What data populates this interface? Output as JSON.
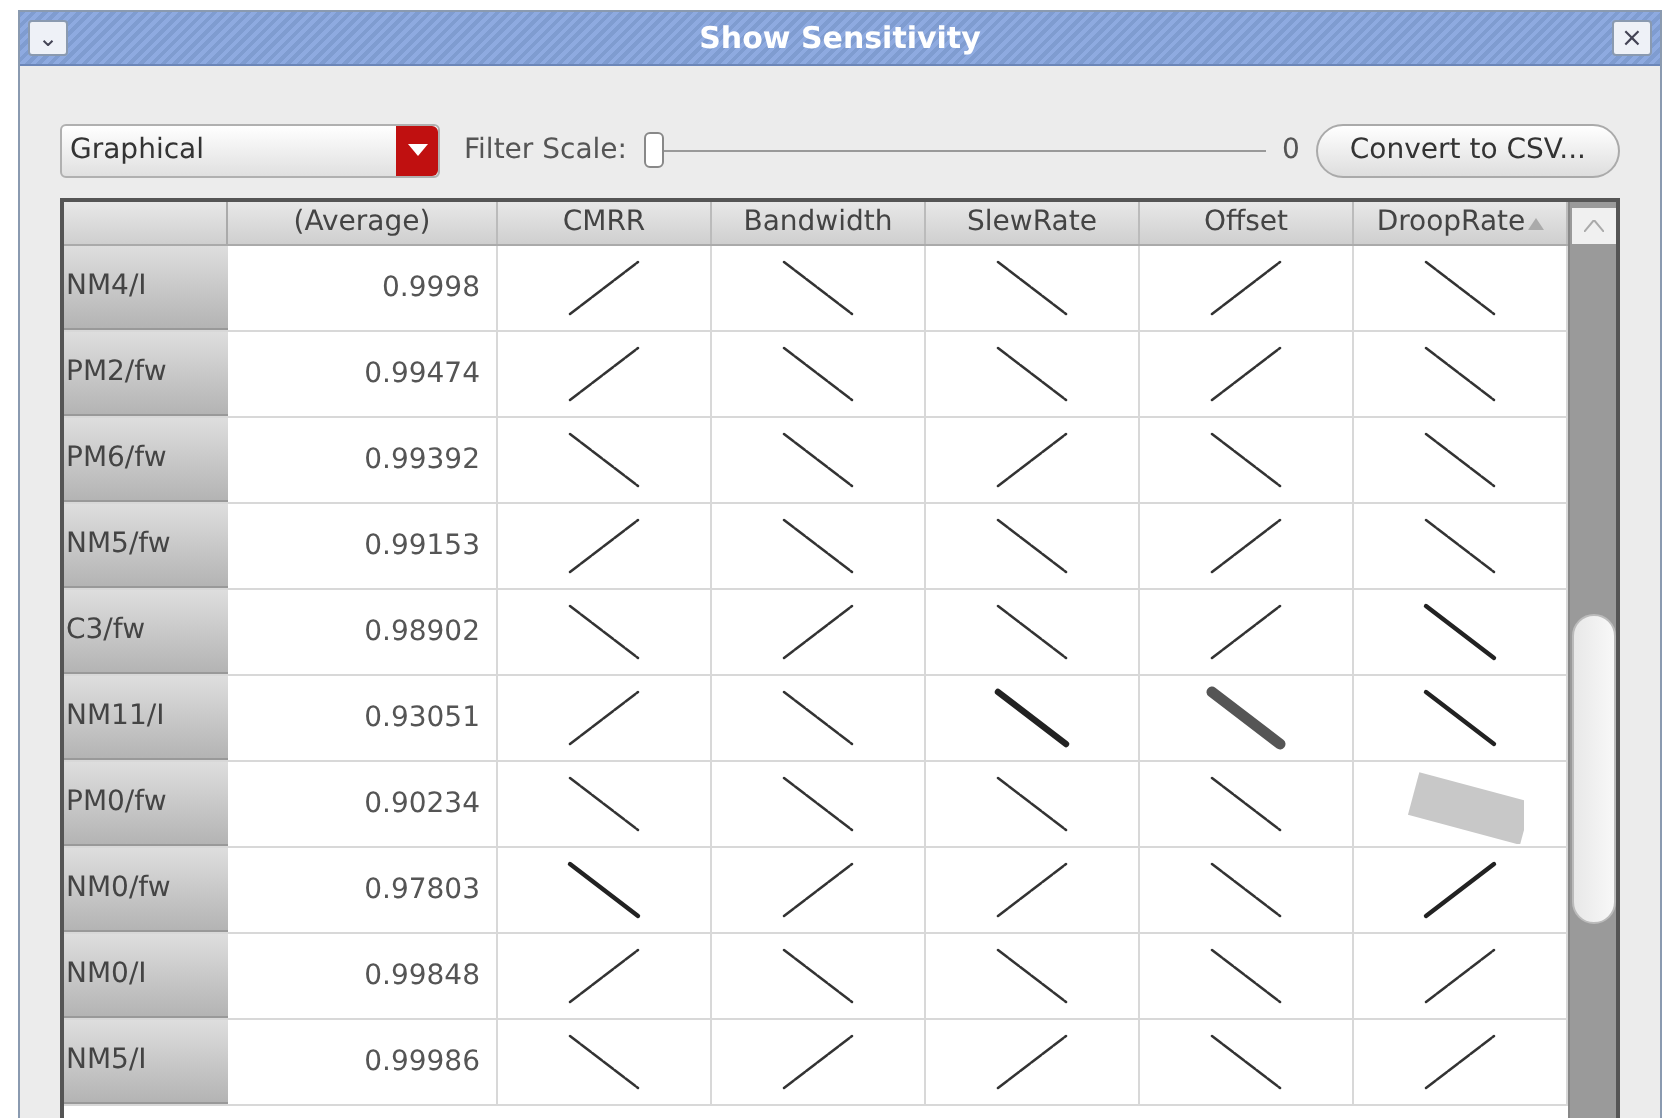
{
  "window": {
    "title": "Show Sensitivity",
    "menu_glyph": "⌄",
    "close_glyph": "×"
  },
  "toolbar": {
    "view": {
      "value": "Graphical"
    },
    "filter": {
      "label": "Filter Scale:",
      "level": 0,
      "reading": "0"
    },
    "convert_button": "Convert to CSV..."
  },
  "table": {
    "columns": [
      {
        "label": "(Average)",
        "sorted": false
      },
      {
        "label": "CMRR",
        "sorted": false
      },
      {
        "label": "Bandwidth",
        "sorted": false
      },
      {
        "label": "SlewRate",
        "sorted": false
      },
      {
        "label": "Offset",
        "sorted": false
      },
      {
        "label": "DroopRate",
        "sorted": true
      }
    ],
    "rows": [
      {
        "name": "NM4/I",
        "average": "0.9998",
        "cells": [
          {
            "kind": "rising"
          },
          {
            "kind": "falling"
          },
          {
            "kind": "falling"
          },
          {
            "kind": "rising"
          },
          {
            "kind": "falling"
          }
        ]
      },
      {
        "name": "PM2/fw",
        "average": "0.99474",
        "cells": [
          {
            "kind": "rising"
          },
          {
            "kind": "falling"
          },
          {
            "kind": "falling"
          },
          {
            "kind": "rising"
          },
          {
            "kind": "falling"
          }
        ]
      },
      {
        "name": "PM6/fw",
        "average": "0.99392",
        "cells": [
          {
            "kind": "falling"
          },
          {
            "kind": "falling"
          },
          {
            "kind": "rising"
          },
          {
            "kind": "falling"
          },
          {
            "kind": "falling"
          }
        ]
      },
      {
        "name": "NM5/fw",
        "average": "0.99153",
        "cells": [
          {
            "kind": "rising"
          },
          {
            "kind": "falling"
          },
          {
            "kind": "falling"
          },
          {
            "kind": "rising"
          },
          {
            "kind": "falling"
          }
        ]
      },
      {
        "name": "C3/fw",
        "average": "0.98902",
        "cells": [
          {
            "kind": "falling"
          },
          {
            "kind": "rising"
          },
          {
            "kind": "falling"
          },
          {
            "kind": "rising"
          },
          {
            "kind": "falling-medium"
          }
        ]
      },
      {
        "name": "NM11/I",
        "average": "0.93051",
        "cells": [
          {
            "kind": "rising"
          },
          {
            "kind": "falling"
          },
          {
            "kind": "falling-heavy"
          },
          {
            "kind": "falling-bold"
          },
          {
            "kind": "falling-medium"
          }
        ]
      },
      {
        "name": "PM0/fw",
        "average": "0.90234",
        "cells": [
          {
            "kind": "falling"
          },
          {
            "kind": "falling"
          },
          {
            "kind": "falling"
          },
          {
            "kind": "falling"
          },
          {
            "kind": "block"
          }
        ]
      },
      {
        "name": "NM0/fw",
        "average": "0.97803",
        "cells": [
          {
            "kind": "falling-medium"
          },
          {
            "kind": "rising"
          },
          {
            "kind": "rising"
          },
          {
            "kind": "falling"
          },
          {
            "kind": "rising-medium"
          }
        ]
      },
      {
        "name": "NM0/I",
        "average": "0.99848",
        "cells": [
          {
            "kind": "rising"
          },
          {
            "kind": "falling"
          },
          {
            "kind": "falling"
          },
          {
            "kind": "falling"
          },
          {
            "kind": "rising"
          }
        ]
      },
      {
        "name": "NM5/I",
        "average": "0.99986",
        "cells": [
          {
            "kind": "falling"
          },
          {
            "kind": "rising"
          },
          {
            "kind": "rising"
          },
          {
            "kind": "falling"
          },
          {
            "kind": "rising"
          }
        ]
      }
    ]
  }
}
